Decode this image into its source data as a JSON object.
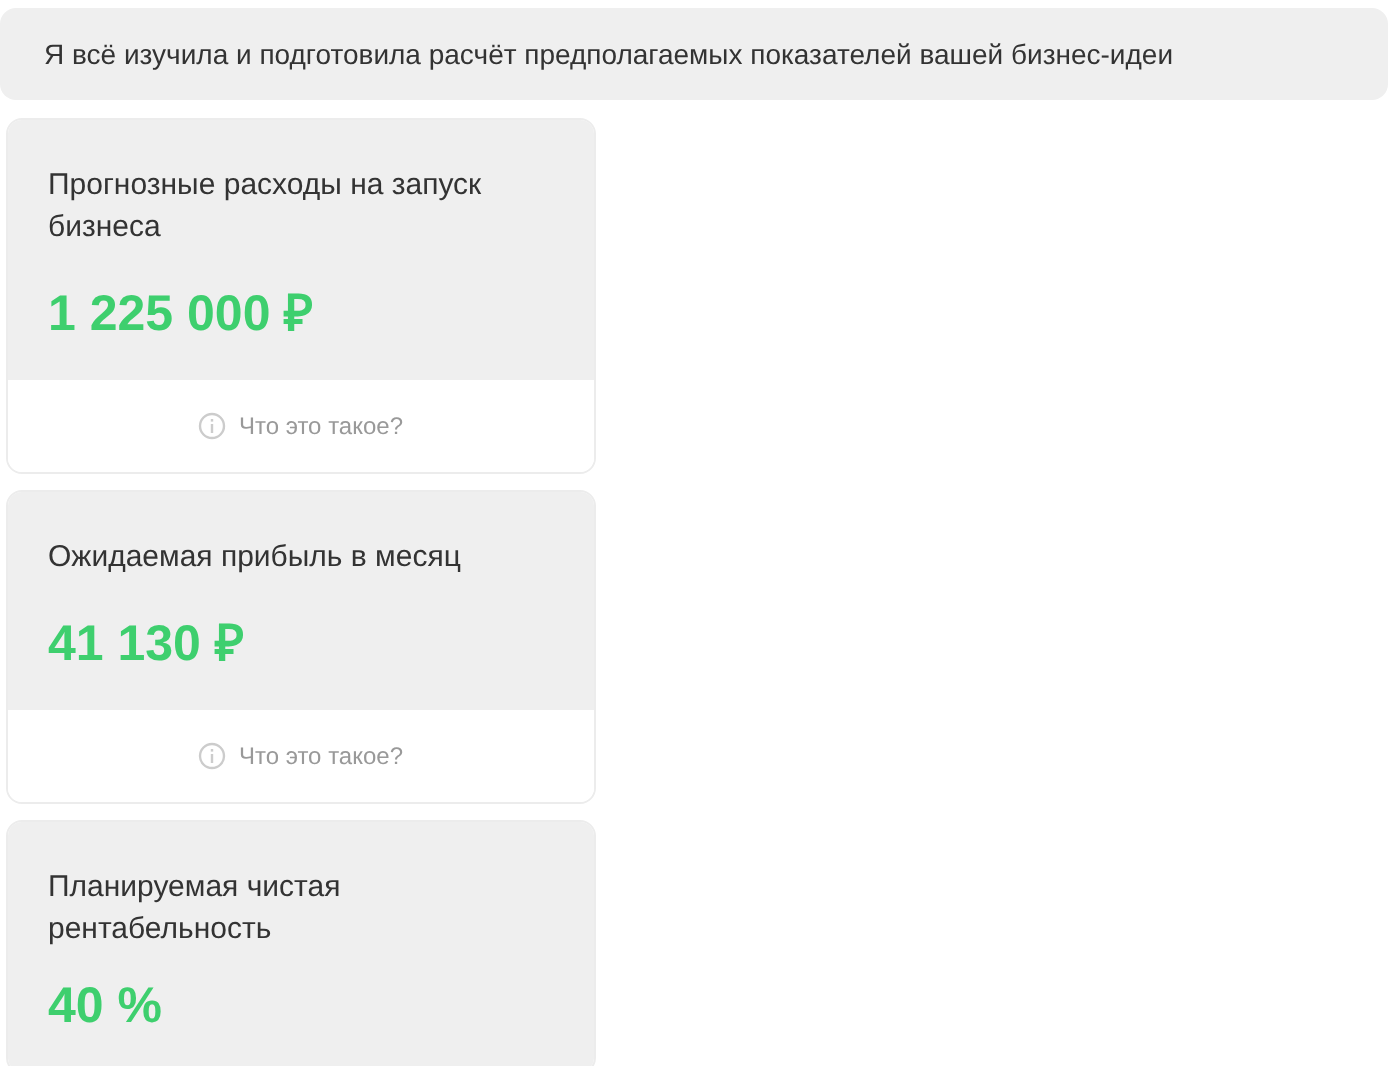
{
  "message": "Я всё изучила и подготовила расчёт предполагаемых показателей вашей бизнес-идеи",
  "cards": [
    {
      "title": "Прогнозные расходы на запуск бизнеса",
      "value": "1 225 000 ₽",
      "help": "Что это такое?"
    },
    {
      "title": "Ожидаемая прибыль в месяц",
      "value": "41 130 ₽",
      "help": "Что это такое?"
    },
    {
      "title": "Планируемая чистая рентабельность",
      "value": "40 %"
    }
  ]
}
